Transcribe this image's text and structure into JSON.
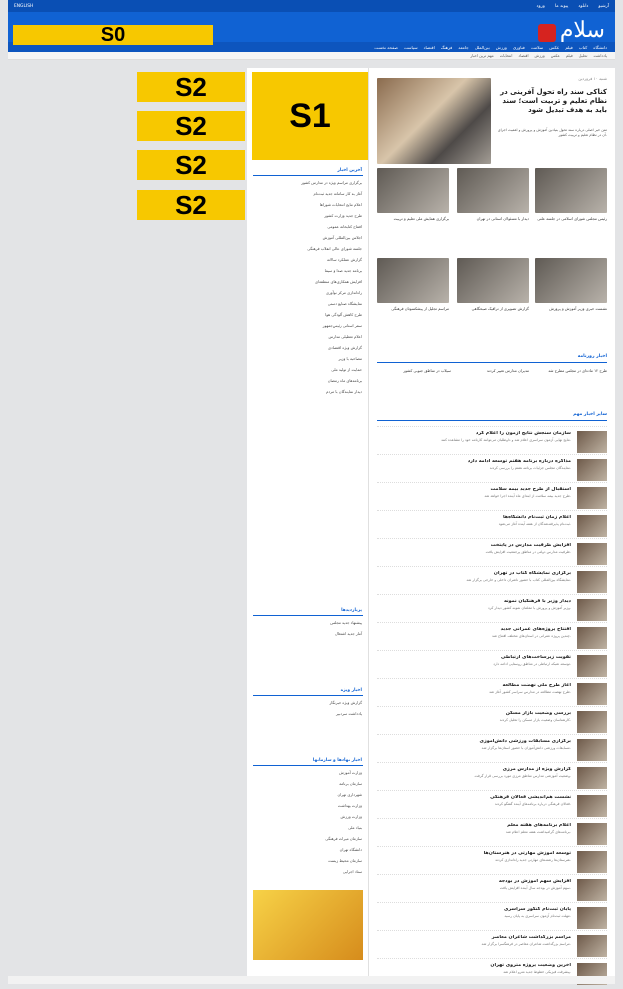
{
  "overlays": {
    "s0": "S0",
    "s1": "S1",
    "s2": "S2"
  },
  "logo": {
    "text": "سلام"
  },
  "topbar": {
    "left": "ENGLISH",
    "items": [
      "ورود",
      "پیوند ما",
      "دانلود",
      "آرشیو"
    ]
  },
  "nav": {
    "items": [
      "صفحه نخست",
      "سیاست",
      "اقتصاد",
      "فرهنگ",
      "جامعه",
      "بین‌الملل",
      "ورزش",
      "فناوری",
      "سلامت",
      "عکس",
      "فیلم",
      "کتاب",
      "دانشگاه"
    ]
  },
  "subnav": {
    "items": [
      "مهم ترین اخبار",
      "انتخابات",
      "اقتصاد",
      "ورزش",
      "عکس",
      "فیلم",
      "تحلیل",
      "یادداشت"
    ]
  },
  "lead": {
    "kicker": "شنبه ۱۰ فروردین",
    "title": "کناکی سند راه تحول آفرینی در نظام تعلیم و تربیت است؛ سند باید به هدف تبدیل شود",
    "body": "متن خبر اصلی درباره سند تحول بنیادین آموزش و پرورش و اهمیت اجرای آن در نظام تعلیم و تربیت کشور."
  },
  "thumbs": [
    {
      "caption": "رئیس مجلس شورای اسلامی در جلسه علنی"
    },
    {
      "caption": "دیدار با مسئولان استانی در تهران"
    },
    {
      "caption": "برگزاری همایش ملی تعلیم و تربیت"
    },
    {
      "caption": "نشست خبری وزیر آموزش و پرورش"
    },
    {
      "caption": "گزارش تصویری از ترافیک صبحگاهی"
    },
    {
      "caption": "مراسم تجلیل از پیشکسوتان فرهنگی"
    }
  ],
  "sections": {
    "latest": "اخبار روزنامه",
    "more": "سایر اخبار مهم",
    "sideTop": "آخرین اخبار",
    "sideB": "پربازدیدها",
    "sideC": "اخبار ویژه",
    "sideD": "اخبار نهادها و سازمانها"
  },
  "latest": [
    "طرح ۱۲ ماده‌ای در مجلس مطرح شد",
    "مدیران مدارس تغییر کردند",
    "سیلاب در مناطق جنوبی کشور"
  ],
  "news": [
    {
      "title": "سازمان سنجش نتایج آزمون را اعلام کرد",
      "text": "نتایج نهایی آزمون سراسری اعلام شد و داوطلبان می‌توانند کارنامه خود را مشاهده کنند."
    },
    {
      "title": "مذاکره درباره برنامه هفتم توسعه ادامه دارد",
      "text": "نمایندگان مجلس جزئیات برنامه هفتم را بررسی کردند."
    },
    {
      "title": "استقبال از طرح جدید بیمه سلامت",
      "text": "طرح جدید بیمه سلامت از ابتدای ماه آینده اجرا خواهد شد."
    },
    {
      "title": "اعلام زمان ثبت‌نام دانشگاه‌ها",
      "text": "ثبت‌نام پذیرفته‌شدگان از هفته آینده آغاز می‌شود."
    },
    {
      "title": "افزایش ظرفیت مدارس در پایتخت",
      "text": "ظرفیت مدارس دولتی در مناطق پرجمعیت افزایش یافت."
    },
    {
      "title": "برگزاری نمایشگاه کتاب در تهران",
      "text": "نمایشگاه بین‌المللی کتاب با حضور ناشران داخلی و خارجی برگزار شد."
    },
    {
      "title": "دیدار وزیر با فرهنگیان نمونه",
      "text": "وزیر آموزش و پرورش با معلمان نمونه کشور دیدار کرد."
    },
    {
      "title": "افتتاح پروژه‌های عمرانی جدید",
      "text": "چندین پروژه عمرانی در استان‌های مختلف افتتاح شد."
    },
    {
      "title": "تقویت زیرساخت‌های ارتباطی",
      "text": "توسعه شبکه ارتباطی در مناطق روستایی ادامه دارد."
    },
    {
      "title": "آغاز طرح ملی نهضت مطالعه",
      "text": "طرح نهضت مطالعه در مدارس سراسر کشور آغاز شد."
    },
    {
      "title": "بررسی وضعیت بازار مسکن",
      "text": "کارشناسان وضعیت بازار مسکن را تحلیل کردند."
    },
    {
      "title": "برگزاری مسابقات ورزشی دانش‌آموزی",
      "text": "مسابقات ورزشی دانش‌آموزان با حضور استان‌ها برگزار شد."
    },
    {
      "title": "گزارش ویژه از مدارس مرزی",
      "text": "وضعیت آموزشی مدارس مناطق مرزی مورد بررسی قرار گرفت."
    },
    {
      "title": "نشست هم‌اندیشی فعالان فرهنگی",
      "text": "فعالان فرهنگی درباره برنامه‌های آینده گفتگو کردند."
    },
    {
      "title": "اعلام برنامه‌های هفته معلم",
      "text": "برنامه‌های گرامیداشت هفته معلم اعلام شد."
    },
    {
      "title": "توسعه آموزش مهارتی در هنرستان‌ها",
      "text": "هنرستان‌ها رشته‌های مهارتی جدید راه‌اندازی کردند."
    },
    {
      "title": "افزایش سهم آموزش در بودجه",
      "text": "سهم آموزش در بودجه سال آینده افزایش یافت."
    },
    {
      "title": "پایان ثبت‌نام کنکور سراسری",
      "text": "مهلت ثبت‌نام آزمون سراسری به پایان رسید."
    },
    {
      "title": "مراسم بزرگداشت شاعران معاصر",
      "text": "مراسم بزرگداشت شاعران معاصر در فرهنگسرا برگزار شد."
    },
    {
      "title": "آخرین وضعیت پروژه متروی تهران",
      "text": "پیشرفت فیزیکی خطوط جدید مترو اعلام شد."
    }
  ],
  "side": {
    "top": [
      "برگزاری مراسم ویژه در مدارس کشور",
      "آغاز به کار سامانه جدید ثبت‌نام",
      "اعلام نتایج انتخابات شوراها",
      "طرح جدید وزارت کشور",
      "افتتاح کتابخانه عمومی",
      "اجلاس بین‌المللی آموزش",
      "جلسه شورای عالی انقلاب فرهنگی",
      "گزارش عملکرد سالانه",
      "برنامه جدید صدا و سیما",
      "افزایش همکاری‌های منطقه‌ای",
      "راه‌اندازی مرکز نوآوری",
      "نمایشگاه صنایع دستی",
      "طرح کاهش آلودگی هوا",
      "سفر استانی رئیس‌جمهور",
      "اعلام تعطیلی مدارس",
      "گزارش ویژه اقتصادی",
      "مصاحبه با وزیر",
      "حمایت از تولید ملی",
      "برنامه‌های ماه رمضان",
      "دیدار نمایندگان با مردم"
    ],
    "b": [
      "پیشنهاد جدید مجلس",
      "آمار جدید اشتغال"
    ],
    "c": [
      "گزارش ویژه خبرنگار",
      "یادداشت سردبیر"
    ],
    "d": [
      "وزارت آموزش",
      "سازمان برنامه",
      "شهرداری تهران",
      "وزارت بهداشت",
      "وزارت ورزش",
      "بنیاد ملی",
      "سازمان میراث فرهنگی",
      "دانشگاه تهران",
      "سازمان محیط زیست",
      "ستاد اجرایی"
    ]
  }
}
